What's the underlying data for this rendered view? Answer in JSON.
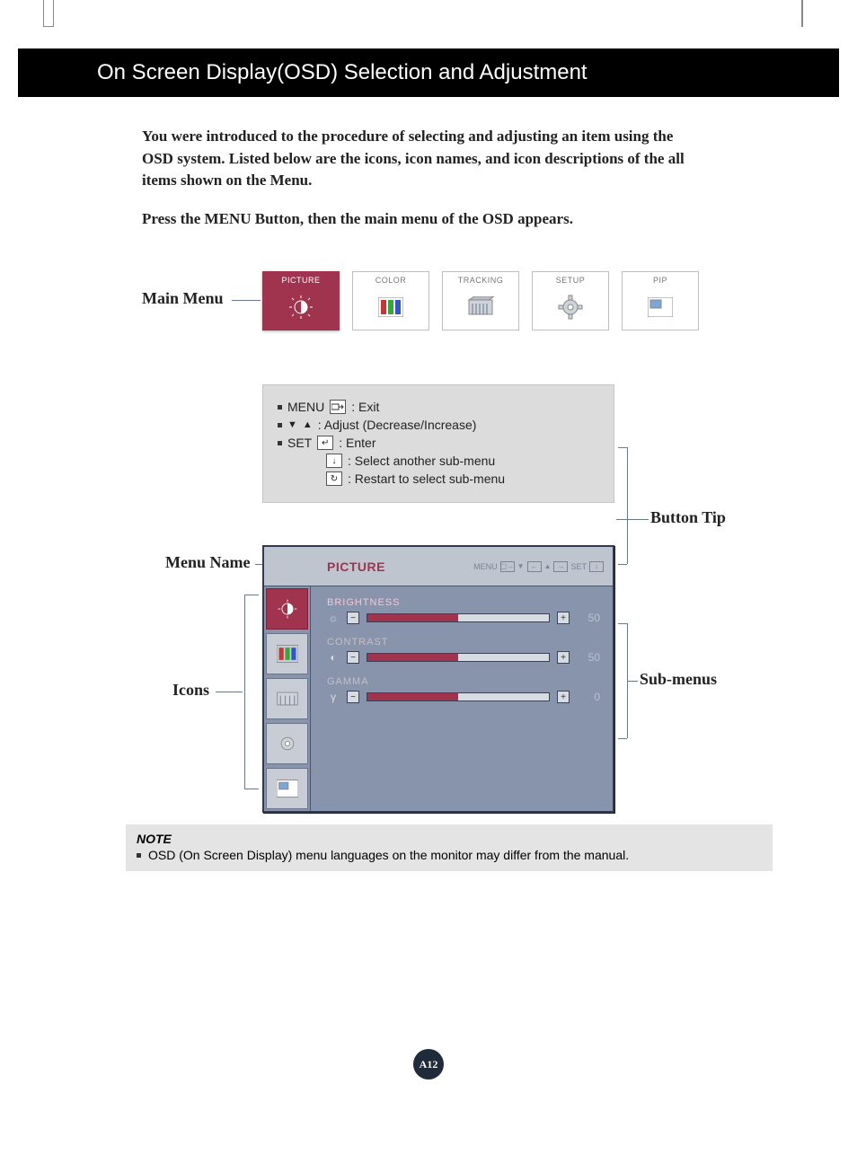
{
  "header": {
    "title": "On Screen Display(OSD) Selection and Adjustment"
  },
  "intro": {
    "p1": "You were introduced to the procedure of selecting and adjusting an item using the OSD system.  Listed below are the icons, icon names, and icon descriptions of the all items shown on the Menu.",
    "p2": "Press the MENU Button, then the main menu of the OSD appears."
  },
  "labels": {
    "mainMenu": "Main Menu",
    "buttonTip": "Button Tip",
    "menuName": "Menu Name",
    "icons": "Icons",
    "subMenus": "Sub-menus"
  },
  "mainMenu": {
    "items": [
      {
        "label": "PICTURE",
        "active": true
      },
      {
        "label": "COLOR",
        "active": false
      },
      {
        "label": "TRACKING",
        "active": false
      },
      {
        "label": "SETUP",
        "active": false
      },
      {
        "label": "PIP",
        "active": false
      }
    ]
  },
  "legend": {
    "menu_word": "MENU",
    "exit": ": Exit",
    "adjust": ": Adjust (Decrease/Increase)",
    "set_word": "SET",
    "enter": ": Enter",
    "select_another": ": Select another sub-menu",
    "restart": ": Restart to select sub-menu"
  },
  "osd": {
    "title": "PICTURE",
    "header": {
      "menu": "MENU",
      "set": "SET"
    },
    "items": [
      {
        "name": "BRIGHTNESS",
        "value": "50",
        "fill_pct": 50,
        "glyph": "☼"
      },
      {
        "name": "CONTRAST",
        "value": "50",
        "fill_pct": 50,
        "glyph": "◐"
      },
      {
        "name": "GAMMA",
        "value": "0",
        "fill_pct": 50,
        "glyph": "γ"
      }
    ]
  },
  "note": {
    "heading": "NOTE",
    "text": "OSD (On Screen Display) menu languages on the monitor may differ from the manual."
  },
  "page": "A12"
}
